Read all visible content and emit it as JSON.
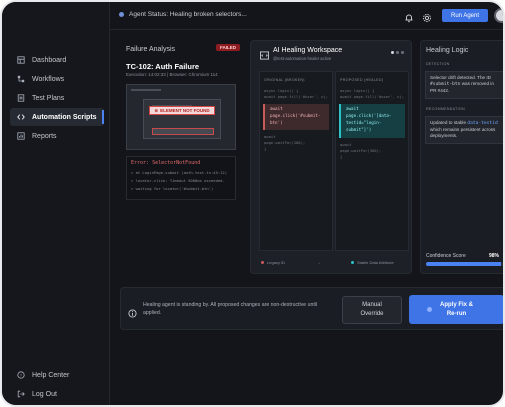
{
  "app": {
    "logo": "",
    "colors": {
      "accent": "#3f74e6",
      "danger": "#8e1d22",
      "fix": "#2cc2c8",
      "bg": "#13151a"
    }
  },
  "sidebar": {
    "items": [
      {
        "label": "Dashboard",
        "icon": "dashboard-icon",
        "active": false
      },
      {
        "label": "Workflows",
        "icon": "workflow-icon",
        "active": false
      },
      {
        "label": "Test Plans",
        "icon": "clipboard-icon",
        "active": false
      },
      {
        "label": "Automation Scripts",
        "icon": "code-icon",
        "active": true
      },
      {
        "label": "Reports",
        "icon": "chart-icon",
        "active": false
      }
    ],
    "footer": [
      {
        "label": "Help Center",
        "icon": "help-icon"
      },
      {
        "label": "Log Out",
        "icon": "logout-icon"
      }
    ]
  },
  "topbar": {
    "status": "Agent Status: Healing broken selectors...",
    "run_label": "Run Agent"
  },
  "failure": {
    "title": "Failure Analysis",
    "badge": "FAILED",
    "test_name": "TC-102: Auth Failure",
    "meta": "Execution: 14:02:33 | Browser: Chromium 114",
    "element_not_found": "ELEMENT NOT FOUND",
    "error_title": "Error: SelectorNotFound",
    "error_lines": [
      "> at LoginPage.submit (auth.test.ts:45:12)",
      "> locator.click: Timeout 5000ms exceeded.",
      "> waiting for locator('#submit-btn')"
    ]
  },
  "workspace": {
    "title": "AI Healing Workspace",
    "subtitle": "@test-automation-healer active",
    "original": {
      "header": "ORIGINAL (BROKEN)",
      "lines_before": [
        "async login() {",
        "  await page.fill('#user', u);"
      ],
      "highlight": [
        "await",
        "page.click('#submit-",
        "btn')"
      ],
      "lines_after": [
        "await",
        "page.waitFor(300);",
        "}"
      ]
    },
    "proposed": {
      "header": "PROPOSED (HEALED)",
      "lines_before": [
        "async login() {",
        "  await page.fill('#user', u);"
      ],
      "highlight": [
        "await",
        "page.click('[data-",
        "testid=\"login-",
        "submit\"]')"
      ],
      "lines_after": [
        "await",
        "page.waitFor(300);",
        "}"
      ]
    },
    "legend_old": "Legacy ID",
    "legend_arrow": "→",
    "legend_new": "Stable Data Attribute"
  },
  "logic": {
    "title": "Healing Logic",
    "detection_label": "DETECTION",
    "detection_text_1": "Selector drift detected. The ID ",
    "detection_code": "#submit-btn",
    "detection_text_2": " was removed in PR #442.",
    "recommendation_label": "RECOMMENDATION",
    "recommendation_text_1": "Updated to stable ",
    "recommendation_code": "data-testid",
    "recommendation_text_2": " which remains persistent across deployments.",
    "confidence_label": "Confidence Score",
    "confidence_value": "98%",
    "confidence_fraction": 0.98
  },
  "action_bar": {
    "info": "Healing agent is standing by. All proposed changes are non-destructive until applied.",
    "manual_line1": "Manual",
    "manual_line2": "Override",
    "apply_line1": "Apply Fix &",
    "apply_line2": "Re-run"
  }
}
